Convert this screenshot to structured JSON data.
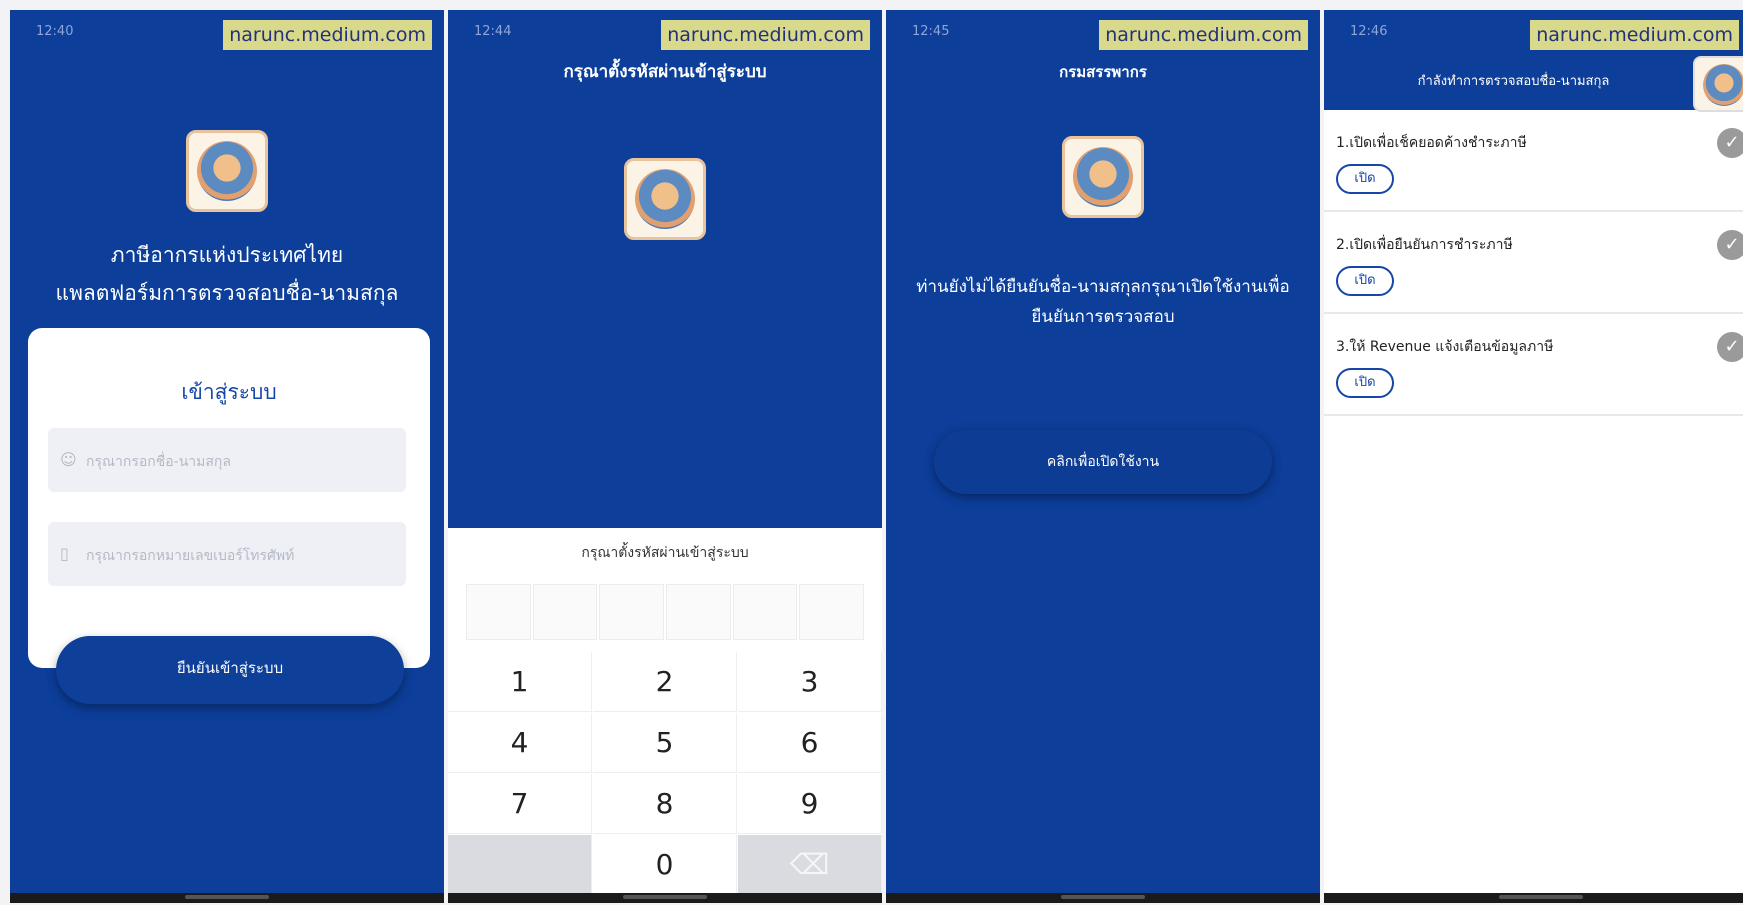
{
  "watermark": "narunc.medium.com",
  "screen1": {
    "status_time": "12:40",
    "title_line1": "ภาษีอากรแห่งประเทศไทย",
    "title_line2": "แพลตฟอร์มการตรวจสอบชื่อ-นามสกุล",
    "card_title": "เข้าสู่ระบบ",
    "name_placeholder": "กรุณากรอกชื่อ-นามสกุล",
    "phone_placeholder": "กรุณากรอกหมายเลขเบอร์โทรศัพท์",
    "submit_label": "ยืนยันเข้าสู่ระบบ",
    "user_icon": "user-icon",
    "phone_icon": "phone-icon"
  },
  "screen2": {
    "status_time": "12:44",
    "header": "กรุณาตั้งรหัสผ่านเข้าสู่ระบบ",
    "pin_label": "กรุณาตั้งรหัสผ่านเข้าสู่ระบบ",
    "keys": [
      "1",
      "2",
      "3",
      "4",
      "5",
      "6",
      "7",
      "8",
      "9",
      "",
      "0",
      "⌫"
    ]
  },
  "screen3": {
    "status_time": "12:45",
    "header": "กรมสรรพากร",
    "message": "ท่านยังไม่ได้ยืนยันชื่อ-นามสกุลกรุณาเปิดใช้งานเพื่อยืนยันการตรวจสอบ",
    "button_label": "คลิกเพื่อเปิดใช้งาน"
  },
  "screen4": {
    "status_time": "12:46",
    "header": "กำลังทำการตรวจสอบชื่อ-นามสกุล",
    "items": [
      {
        "text": "1.เปิดเพื่อเช็คยอดค้างชำระภาษี",
        "button": "เปิด"
      },
      {
        "text": "2.เปิดเพื่อยืนยันการชำระภาษี",
        "button": "เปิด"
      },
      {
        "text": "3.ให้ Revenue แจ้งเตือนข้อมูลภาษี",
        "button": "เปิด"
      }
    ],
    "check_icon": "check-circle-icon"
  }
}
